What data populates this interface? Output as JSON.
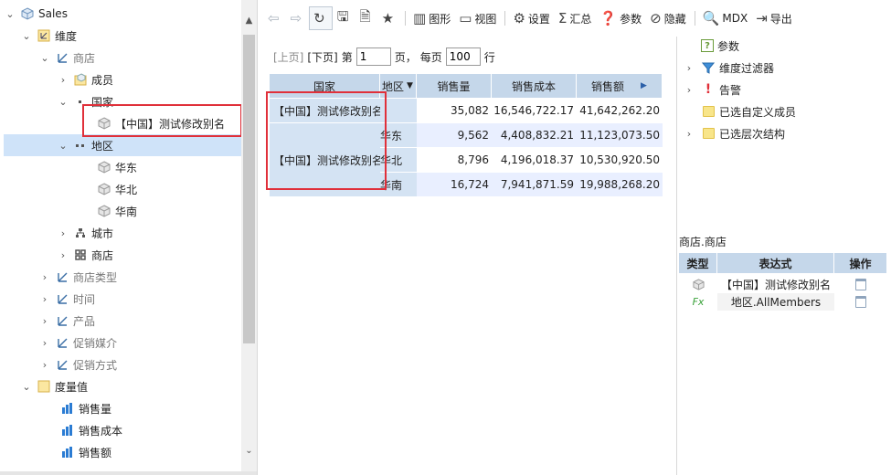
{
  "tree": {
    "root_label": "Sales",
    "dimension_group": "维度",
    "store": "商店",
    "members": "成员",
    "country": "国家",
    "china_alias": "【中国】测试修改别名",
    "region": "地区",
    "east": "华东",
    "north": "华北",
    "south": "华南",
    "city": "城市",
    "store_level": "商店",
    "store_type": "商店类型",
    "time": "时间",
    "product": "产品",
    "promo_media": "促销媒介",
    "promo_method": "促销方式",
    "measures_group": "度量值",
    "m1": "销售量",
    "m2": "销售成本",
    "m3": "销售额"
  },
  "toolbar": {
    "refresh": "↻",
    "chart": "图形",
    "view": "视图",
    "settings": "设置",
    "summary": "汇总",
    "params": "参数",
    "hide": "隐藏",
    "mdx": "MDX",
    "export": "导出"
  },
  "pager": {
    "prev": "[上页]",
    "next": "[下页]",
    "page_label": "第",
    "page_value": "1",
    "page_suffix": "页，",
    "per_page_label": "每页",
    "per_page_value": "100",
    "rows_suffix": "行"
  },
  "grid": {
    "headers": [
      "国家",
      "地区",
      "销售量",
      "销售成本",
      "销售额"
    ],
    "country_row1": "【中国】测试修改别名",
    "country_row2": "【中国】测试修改别名",
    "rows": [
      {
        "region": "",
        "qty": "35,082",
        "cost": "16,546,722.17",
        "amount": "41,642,262.20"
      },
      {
        "region": "华东",
        "qty": "9,562",
        "cost": "4,408,832.21",
        "amount": "11,123,073.50"
      },
      {
        "region": "华北",
        "qty": "8,796",
        "cost": "4,196,018.37",
        "amount": "10,530,920.50"
      },
      {
        "region": "华南",
        "qty": "16,724",
        "cost": "7,941,871.59",
        "amount": "19,988,268.20"
      }
    ]
  },
  "right_panel": {
    "items": [
      "参数",
      "维度过滤器",
      "告警",
      "已选自定义成员",
      "已选层次结构"
    ],
    "caption": "商店.商店",
    "table_headers": [
      "类型",
      "表达式",
      "操作"
    ],
    "table_rows": [
      {
        "type_icon": "cube-icon",
        "expr": "【中国】测试修改别名"
      },
      {
        "type_icon": "fx-icon",
        "type_text": "Fx",
        "expr": "地区.AllMembers"
      }
    ]
  },
  "colors": {
    "selection": "#cfe3f9",
    "header": "#c5d7ea",
    "row_alt": "#e9efff",
    "highlight_red": "#e0303a"
  }
}
